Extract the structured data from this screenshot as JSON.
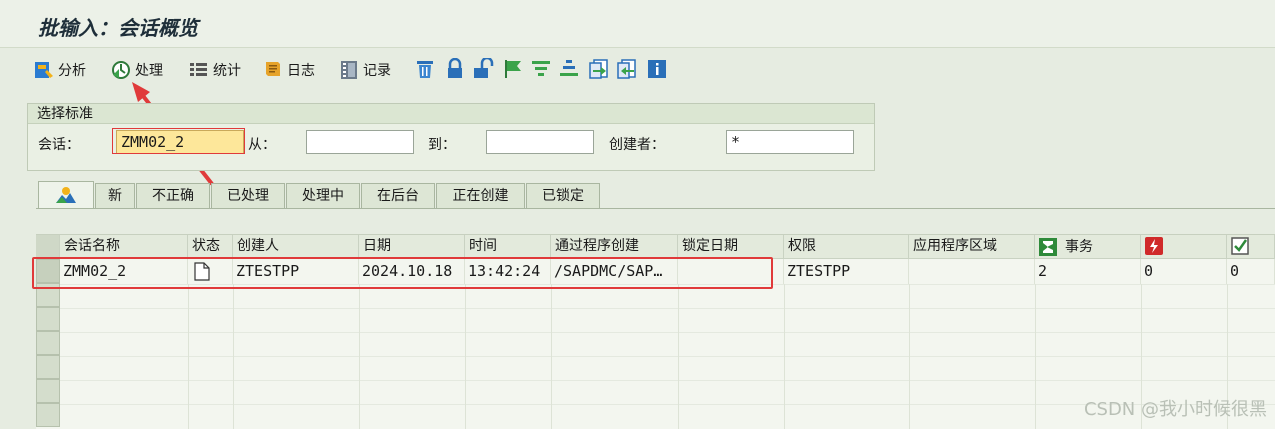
{
  "window": {
    "title": "批输入：会话概览"
  },
  "toolbar": {
    "analyze_label": "分析",
    "process_label": "处理",
    "statistics_label": "统计",
    "log_label": "日志",
    "record_label": "记录"
  },
  "selection": {
    "header": "选择标准",
    "session_label": "会话：",
    "session_value": "ZMM02_2",
    "from_label": "从：",
    "from_value": "",
    "to_label": "到：",
    "to_value": "",
    "creator_label": "创建者：",
    "creator_value": "*"
  },
  "tabs": [
    "新",
    "不正确",
    "已处理",
    "处理中",
    "在后台",
    "正在创建",
    "已锁定"
  ],
  "table": {
    "columns": [
      "会话名称",
      "状态",
      "创建人",
      "日期",
      "时间",
      "通过程序创建",
      "锁定日期",
      "权限",
      "应用程序区域",
      "事务"
    ],
    "rows": [
      {
        "session_name": "ZMM02_2",
        "created_by": "ZTESTPP",
        "date": "2024.10.18",
        "time": "13:42:24",
        "program": "/SAPDMC/SAP…",
        "lock_date": "",
        "authorization": "ZTESTPP",
        "app_area": "",
        "transactions": "2",
        "errors": "0",
        "processed": "0"
      }
    ]
  },
  "watermark": "CSDN @我小时候很黑",
  "colors": {
    "annotation": "#e03a3a",
    "background": "#e6ece1"
  },
  "icons": [
    "analyze-icon",
    "process-icon",
    "statistics-icon",
    "log-icon",
    "record-icon",
    "delete-icon",
    "lock-icon",
    "unlock-icon",
    "flag-icon",
    "filter-icon",
    "sort-icon",
    "export-icon",
    "import-icon",
    "info-icon",
    "overview-tab-icon",
    "sum-icon",
    "error-icon",
    "check-icon",
    "document-icon"
  ]
}
